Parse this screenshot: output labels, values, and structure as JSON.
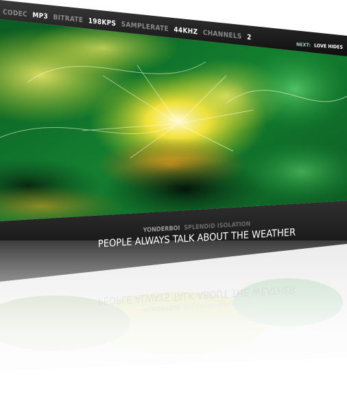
{
  "codec_bar": {
    "codec_label": "CODEC",
    "codec_value": "MP3",
    "bitrate_label": "BITRATE",
    "bitrate_value": "198KPS",
    "samplerate_label": "SAMPLERATE",
    "samplerate_value": "44KHZ",
    "channels_label": "CHANNELS",
    "channels_value": "2"
  },
  "next_track": {
    "label": "NEXT:",
    "title": "LOVE HIDES"
  },
  "now_playing": {
    "artist": "YONDERBOI",
    "album": "SPLENDID ISOLATION",
    "title": "PEOPLE ALWAYS TALK ABOUT THE WEATHER"
  },
  "colors": {
    "visualizer_green": "#0f7a2c",
    "visualizer_yellow": "#f2e23a",
    "bar_dark": "#1c1c1c",
    "text_light": "#ffffff",
    "text_dim": "#8a8a8a"
  }
}
